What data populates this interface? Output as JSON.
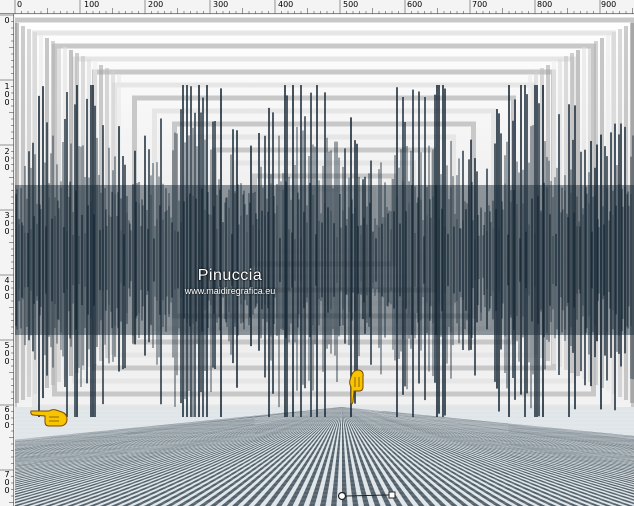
{
  "ruler": {
    "top_labels": [
      "0",
      "100",
      "200",
      "300",
      "400",
      "500",
      "600",
      "700",
      "800",
      "900"
    ],
    "left_labels": [
      "0",
      "1\n0\n0",
      "2\n0\n0",
      "3\n0\n0",
      "4\n0\n0",
      "5\n0\n0",
      "6\n0\n0",
      "7\n0\n0"
    ]
  },
  "watermark": {
    "title": "Pinuccia",
    "url": "www.maidiregrafica.eu"
  },
  "colors": {
    "waveform": "#142634",
    "ruler_bg": "#f4f4f4",
    "hand": "#f7c400"
  },
  "icons": {
    "hand_left": "pointing-hand-icon",
    "hand_down": "pointing-hand-icon",
    "handle": "move-handle-icon"
  }
}
